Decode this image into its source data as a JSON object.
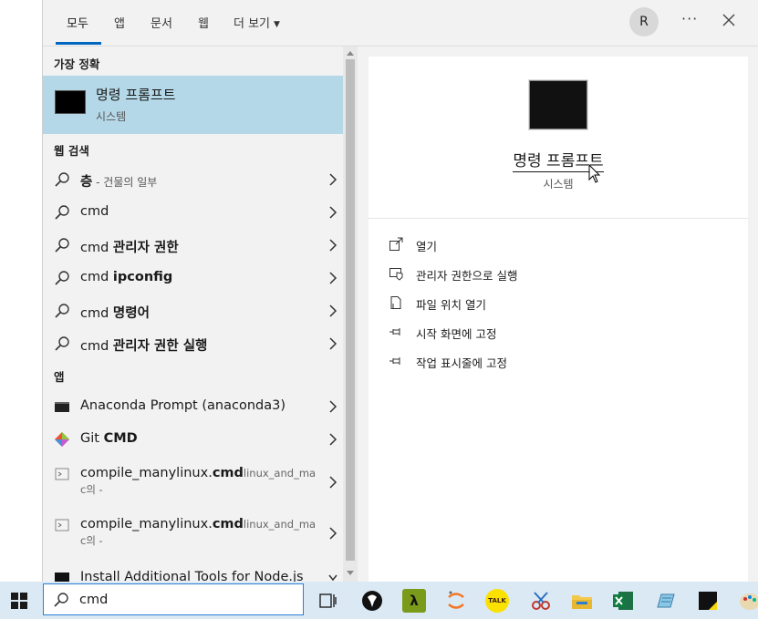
{
  "tabs": {
    "items": [
      "모두",
      "앱",
      "문서",
      "웹",
      "더 보기"
    ],
    "active": "모두",
    "avatar_letter": "R",
    "more_label": "···"
  },
  "results": {
    "best_match_title": "가장 정확",
    "best": {
      "title": "명령 프롬프트",
      "subtitle": "시스템",
      "icon": "cmd-icon"
    },
    "web_title": "웹 검색",
    "web_items": [
      {
        "main": "층",
        "extra": " - 건물의 일부"
      },
      {
        "main": "cmd",
        "extra": ""
      },
      {
        "main": "cmd ",
        "bold": "관리자 권한"
      },
      {
        "main": "cmd ",
        "bold": "ipconfig"
      },
      {
        "main": "cmd ",
        "bold": "명령어"
      },
      {
        "main": "cmd ",
        "bold": "관리자 권한 실행"
      }
    ],
    "apps_title": "앱",
    "app_items": [
      {
        "main": "Anaconda Prompt (anaconda3)",
        "icon": "terminal-icon"
      },
      {
        "main": "Git ",
        "bold": "CMD",
        "icon": "git-icon"
      },
      {
        "main": "compile_manylinux.",
        "bold": "cmd",
        "small": "linux_and_ma",
        "second": "c의 -",
        "icon": "script-icon"
      },
      {
        "main": "compile_manylinux.",
        "bold": "cmd",
        "small": "linux_and_ma",
        "second": "c의 -",
        "icon": "script-icon"
      },
      {
        "main": "Install Additional Tools for Node.js",
        "icon": "terminal-icon"
      }
    ]
  },
  "detail": {
    "title": "명령 프롬프트",
    "subtitle": "시스템",
    "actions": [
      {
        "label": "열기",
        "icon": "open-icon"
      },
      {
        "label": "관리자 권한으로 실행",
        "icon": "shield-icon"
      },
      {
        "label": "파일 위치 열기",
        "icon": "file-location-icon"
      },
      {
        "label": "시작 화면에 고정",
        "icon": "pin-icon"
      },
      {
        "label": "작업 표시줄에 고정",
        "icon": "pin-icon"
      }
    ]
  },
  "taskbar": {
    "search_value": "cmd",
    "apps": [
      "task-view-icon",
      "inkscape-icon",
      "lambda-icon",
      "jupyter-icon",
      "kakaotalk-icon",
      "snipping-icon",
      "file-explorer-icon",
      "excel-icon",
      "notepad-icon",
      "sticky-notes-icon",
      "paint-icon"
    ],
    "kakao_label": "TALK",
    "lambda_label": "λ"
  },
  "colors": {
    "accent": "#0067c0",
    "selected_bg": "#b5d8e8",
    "taskbar_bg": "#dbe9f5",
    "panel_bg": "#f2f2f2"
  }
}
